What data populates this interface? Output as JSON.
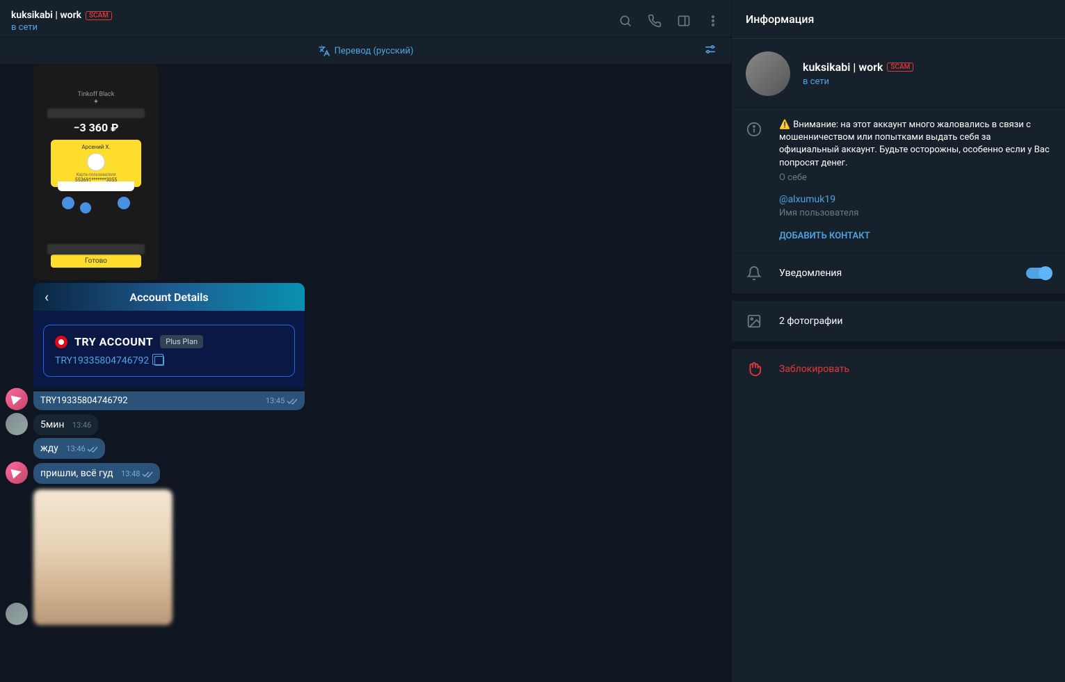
{
  "header": {
    "title": "kuksikabi | work",
    "scam": "SCAM",
    "status": "в сети"
  },
  "translate": {
    "label": "Перевод (русский)"
  },
  "tinkoff": {
    "brand": "Tinkoff Black",
    "plus": "+",
    "amount": "−3 360 ₽",
    "cardName": "Арсений Х.",
    "cardSub": "Карта пользователя",
    "cardNum": "553691*******3055",
    "done": "Готово"
  },
  "account": {
    "headerTitle": "Account Details",
    "name": "TRY ACCOUNT",
    "plan": "Plus Plan",
    "number": "TRY19335804746792"
  },
  "messages": {
    "m1text": "TRY19335804746792",
    "m1time": "13:45",
    "m2text": "5мин",
    "m2time": "13:46",
    "m3text": "жду",
    "m3time": "13:46",
    "m4text": "пришли, всё гуд",
    "m4time": "13:48"
  },
  "side": {
    "title": "Информация",
    "name": "kuksikabi | work",
    "scam": "SCAM",
    "status": "в сети",
    "warning": "Внимание: на этот аккаунт много жаловались в связи с мошенничеством или попытками выдать себя за официальный аккаунт. Будьте осторожны, особенно если у Вас попросят денег.",
    "aboutLabel": "О себе",
    "username": "@alxumuk19",
    "usernameLabel": "Имя пользователя",
    "addContact": "ДОБАВИТЬ КОНТАКТ",
    "notifications": "Уведомления",
    "photos": "2 фотографии",
    "block": "Заблокировать"
  }
}
